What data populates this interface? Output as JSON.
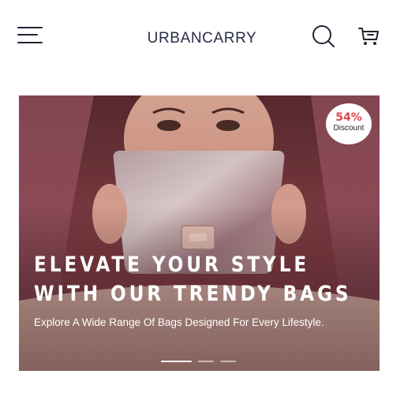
{
  "header": {
    "brand": "URBANCARRY",
    "icons": {
      "menu": "hamburger-menu-icon",
      "search": "search-icon",
      "cart": "cart-icon"
    }
  },
  "hero": {
    "badge": {
      "value": "54%",
      "label": "Discount"
    },
    "title_line1": "ELEVATE YOUR STYLE",
    "title_line2": "WITH OUR TRENDY BAGS",
    "subtitle": "Explore A Wide Range Of Bags Designed For Every Lifestyle.",
    "slides": {
      "count": 3,
      "active": 1
    }
  },
  "colors": {
    "brand_text": "#2a2d48",
    "badge_accent": "#e0484f",
    "hero_text": "#ffffff"
  }
}
